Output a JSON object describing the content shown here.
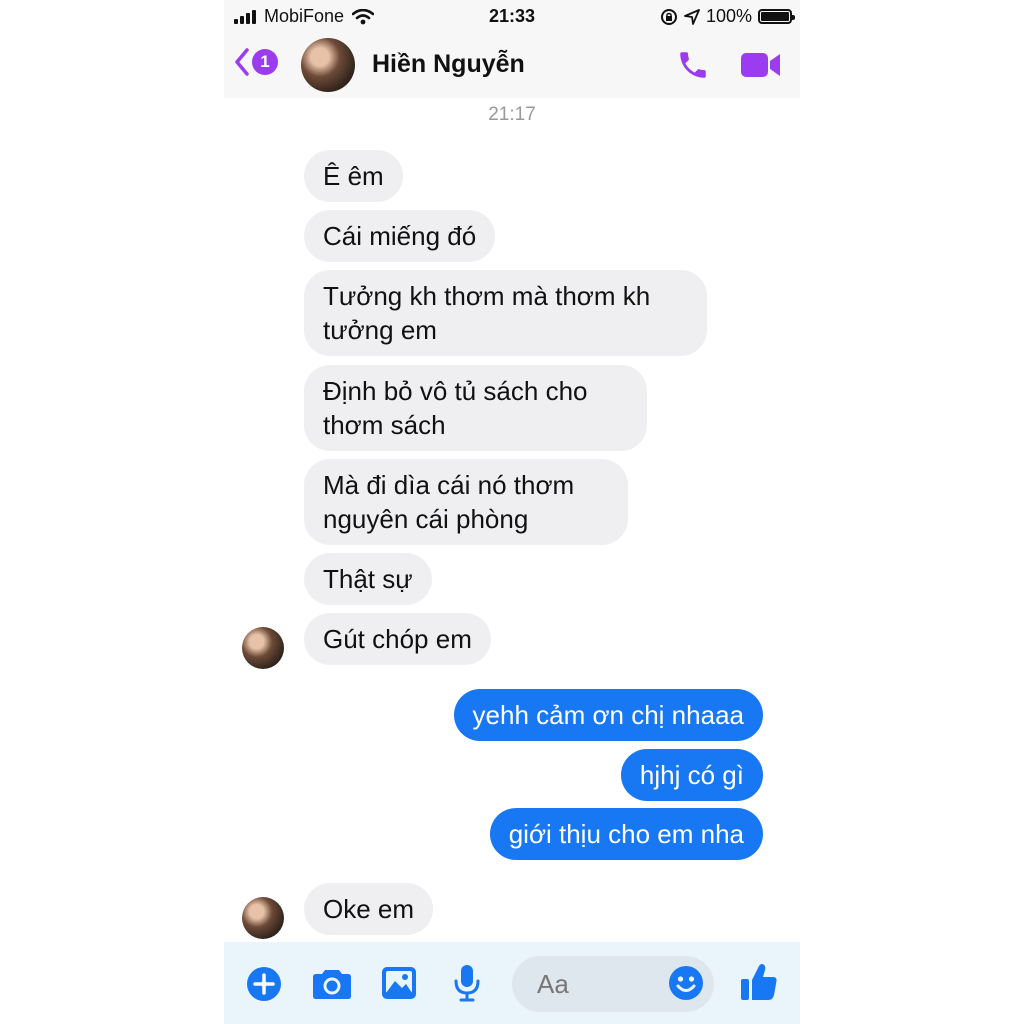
{
  "status_bar": {
    "carrier": "MobiFone",
    "time": "21:33",
    "battery": "100%"
  },
  "header": {
    "unread_count": "1",
    "contact_name": "Hiền Nguyễn"
  },
  "conversation": {
    "timestamp": "21:17",
    "incoming_1": [
      "Ê êm",
      "Cái miếng đó",
      "Tưởng kh thơm mà thơm kh tưởng em",
      "Định bỏ vô tủ sách cho thơm sách",
      "Mà đi dìa cái nó thơm nguyên cái phòng",
      "Thật sự",
      "Gút chóp em"
    ],
    "outgoing": [
      "yehh cảm ơn chị nhaaa",
      "hjhj có gì",
      "giới thịu cho em nha"
    ],
    "incoming_2": [
      "Oke em"
    ]
  },
  "composer": {
    "placeholder": "Aa"
  },
  "colors": {
    "accent": "#9b3cf0",
    "outgoing_bubble": "#1877f2",
    "incoming_bubble": "#efeff1",
    "composer_icons": "#1877f2"
  }
}
